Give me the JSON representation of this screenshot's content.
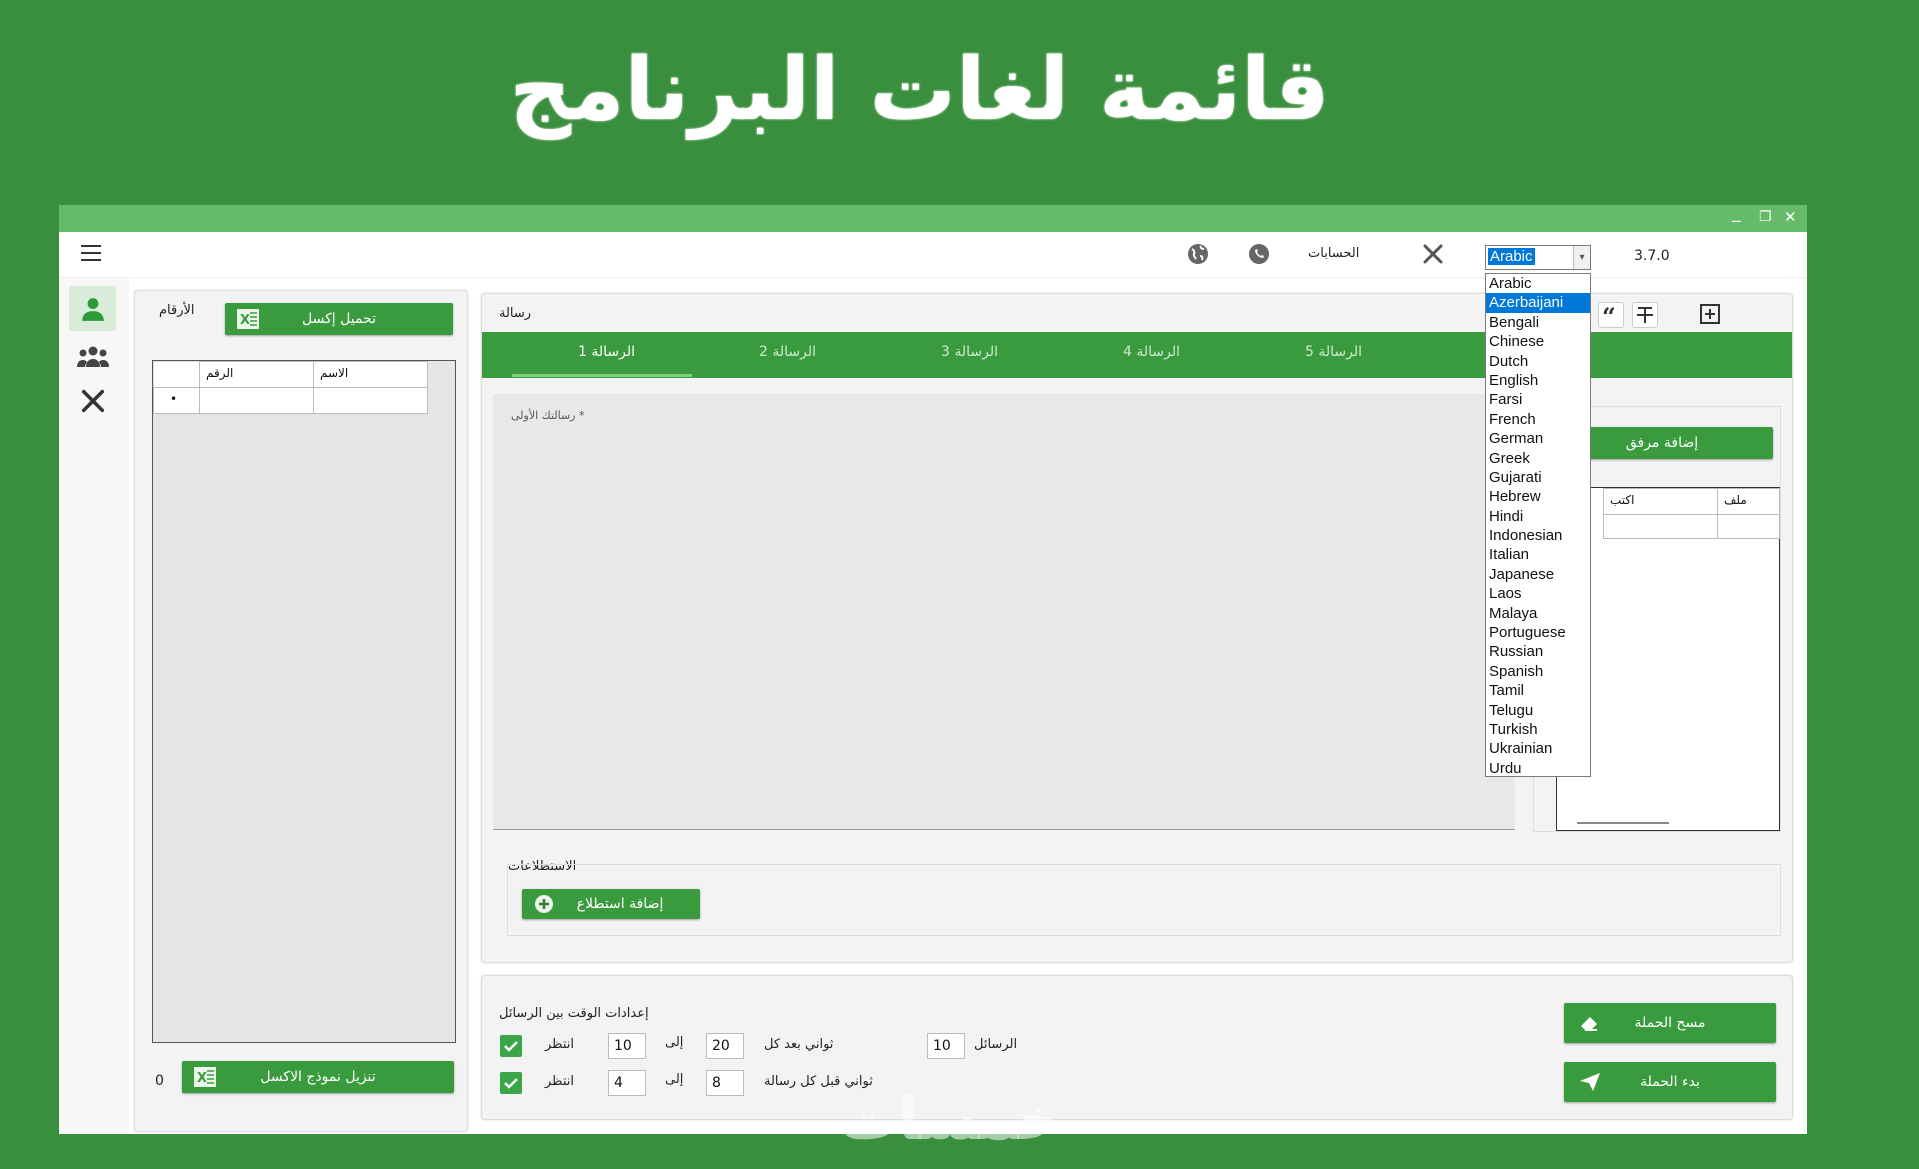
{
  "banner": {
    "title": "قائمة لغات البرنامج"
  },
  "window": {
    "minimize": "_",
    "restore": "❐",
    "close": "✕"
  },
  "topbar": {
    "version": "3.7.0",
    "accounts_label": "الحسابات",
    "language_selected": "Arabic"
  },
  "language_options": [
    "Arabic",
    "Azerbaijani",
    "Bengali",
    "Chinese",
    "Dutch",
    "English",
    "Farsi",
    "French",
    "German",
    "Greek",
    "Gujarati",
    "Hebrew",
    "Hindi",
    "Indonesian",
    "Italian",
    "Japanese",
    "Laos",
    "Malaya",
    "Portuguese",
    "Russian",
    "Spanish",
    "Tamil",
    "Telugu",
    "Turkish",
    "Ukrainian",
    "Urdu"
  ],
  "highlighted_option": "Azerbaijani",
  "numbers_panel": {
    "title": "الأرقام",
    "load_excel": "تحميل إكسل",
    "col_number": "الرقم",
    "col_name": "الاسم",
    "row_marker": "•",
    "download_template": "تنزيل نموذج الاكسل",
    "count": "0"
  },
  "message_panel": {
    "title": "رسالة",
    "tabs": [
      "الرسالة 1",
      "الرسالة 2",
      "الرسالة 3",
      "الرسالة 4",
      "الرسالة 5"
    ],
    "placeholder": "رسالتك الأولى *",
    "polls_label": "الاستطلاعات",
    "add_poll": "إضافة استطلاع",
    "add_attachment": "إضافة مرفق",
    "col_file": "ملف",
    "col_write": "اكتب"
  },
  "timing": {
    "title": "إعدادات الوقت بين الرسائل",
    "wait_label": "انتظر",
    "to_label": "إلى",
    "row1_text": "ثواني بعد كل",
    "row1_from": "10",
    "row1_to": "20",
    "messages_label": "الرسائل",
    "messages_value": "10",
    "row2_text": "ثواني قبل كل رسالة",
    "row2_from": "4",
    "row2_to": "8"
  },
  "campaign": {
    "clear": "مسح الحملة",
    "start": "بدء الحملة"
  },
  "watermark": "خمسات",
  "colors": {
    "primary_green": "#3a9b3e",
    "background_green": "#3a8f3e",
    "titlebar_green": "#66bb6a",
    "highlight_blue": "#0078d7"
  }
}
